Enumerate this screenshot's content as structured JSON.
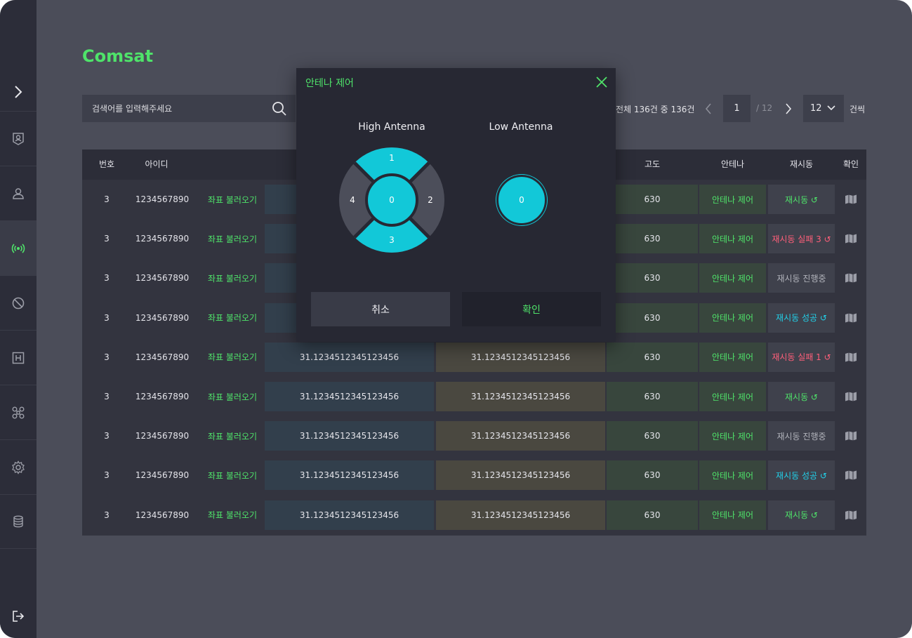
{
  "app": {
    "title": "Comsat",
    "accent": "#4fe36a",
    "cyan": "#12c8d8"
  },
  "sidebar": {
    "items": [
      {
        "icon": "badge-icon"
      },
      {
        "icon": "user-icon"
      },
      {
        "icon": "antenna-signal-icon",
        "active": true
      },
      {
        "icon": "block-icon"
      },
      {
        "icon": "helipad-icon"
      },
      {
        "icon": "drone-icon"
      },
      {
        "icon": "gear-icon"
      },
      {
        "icon": "database-icon"
      }
    ]
  },
  "search": {
    "placeholder": "검색어를 입력해주세요"
  },
  "pagination": {
    "total_text": "전체 136건 중 136건",
    "current_page": "1",
    "of_pages": "/ 12",
    "page_size": "12",
    "unit": "건씩"
  },
  "table": {
    "headers": {
      "no": "번호",
      "id": "아이디",
      "alt": "고도",
      "antenna": "안테나",
      "restart": "재시동",
      "confirm": "확인"
    },
    "coord_label": "좌표 불러오기",
    "antenna_label": "안테나 제어",
    "rows": [
      {
        "no": "3",
        "id": "1234567890",
        "lat": "",
        "lon": "",
        "alt": "630",
        "restart": "재시동 ↺",
        "status": "green"
      },
      {
        "no": "3",
        "id": "1234567890",
        "lat": "",
        "lon": "",
        "alt": "630",
        "restart": "재시동 실패 3 ↺",
        "status": "red"
      },
      {
        "no": "3",
        "id": "1234567890",
        "lat": "",
        "lon": "",
        "alt": "630",
        "restart": "재시동 진행중",
        "status": "gray"
      },
      {
        "no": "3",
        "id": "1234567890",
        "lat": "",
        "lon": "",
        "alt": "630",
        "restart": "재시동 성공 ↺",
        "status": "cyan"
      },
      {
        "no": "3",
        "id": "1234567890",
        "lat": "31.1234512345123456",
        "lon": "31.1234512345123456",
        "alt": "630",
        "restart": "재시동 실패 1 ↺",
        "status": "red"
      },
      {
        "no": "3",
        "id": "1234567890",
        "lat": "31.1234512345123456",
        "lon": "31.1234512345123456",
        "alt": "630",
        "restart": "재시동 ↺",
        "status": "green"
      },
      {
        "no": "3",
        "id": "1234567890",
        "lat": "31.1234512345123456",
        "lon": "31.1234512345123456",
        "alt": "630",
        "restart": "재시동 진행중",
        "status": "gray"
      },
      {
        "no": "3",
        "id": "1234567890",
        "lat": "31.1234512345123456",
        "lon": "31.1234512345123456",
        "alt": "630",
        "restart": "재시동 성공 ↺",
        "status": "cyan"
      },
      {
        "no": "3",
        "id": "1234567890",
        "lat": "31.1234512345123456",
        "lon": "31.1234512345123456",
        "alt": "630",
        "restart": "재시동 ↺",
        "status": "green"
      }
    ]
  },
  "modal": {
    "title": "안테나 제어",
    "high_label": "High Antenna",
    "low_label": "Low Antenna",
    "dpad": {
      "up": "1",
      "right": "2",
      "down": "3",
      "left": "4",
      "center": "0"
    },
    "low_center": "0",
    "cancel_label": "취소",
    "confirm_label": "확인"
  }
}
